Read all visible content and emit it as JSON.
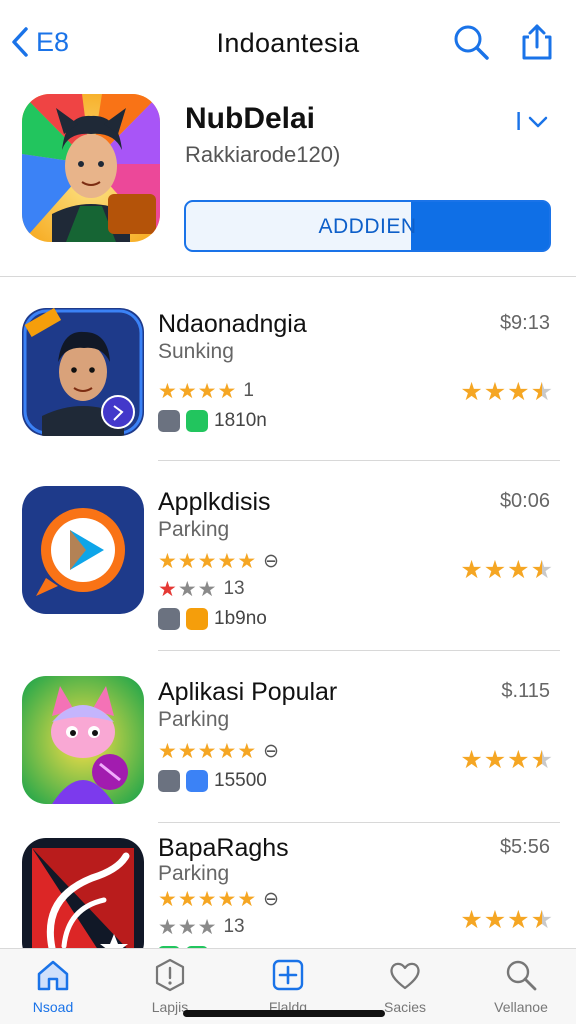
{
  "header": {
    "back_label": "E8",
    "title": "Indoantesia"
  },
  "featured": {
    "name": "NubDelai",
    "subtitle": "Rakkiarode120)",
    "more_label": "I",
    "button_label": "ADDDIEN"
  },
  "apps": [
    {
      "name": "Ndaonadngia",
      "category": "Sunking",
      "price": "$9:13",
      "stars_primary": {
        "value": "1"
      },
      "stars_secondary": null,
      "info_text": "1810n",
      "rating": 3.5
    },
    {
      "name": "Applkdisis",
      "category": "Parking",
      "price": "$0:06",
      "stars_primary": {
        "value": "⊖"
      },
      "stars_secondary": {
        "value": "13"
      },
      "info_text": "1b9no",
      "rating": 3.5
    },
    {
      "name": "Aplikasi Popular",
      "category": "Parking",
      "price": "$.115",
      "stars_primary": {
        "value": "⊖"
      },
      "stars_secondary": null,
      "info_text": "15500",
      "rating": 3.5
    },
    {
      "name": "BapaRaghs",
      "category": "Parking",
      "price": "$5:56",
      "stars_primary": {
        "value": "⊖"
      },
      "stars_secondary": {
        "value": "13"
      },
      "info_text": "",
      "rating": 3.5
    }
  ],
  "tabs": [
    {
      "label": "Nsoad",
      "icon": "home-icon",
      "active": true
    },
    {
      "label": "Lapjis",
      "icon": "hexagon-alert-icon",
      "active": false
    },
    {
      "label": "Flaldg",
      "icon": "plus-square-icon",
      "active": false
    },
    {
      "label": "Sacies",
      "icon": "heart-icon",
      "active": false
    },
    {
      "label": "Vellanoe",
      "icon": "search-icon",
      "active": false
    }
  ],
  "colors": {
    "accent": "#1a73e8",
    "star_gold": "#f5a623",
    "star_grey": "#8a8a8a",
    "star_red": "#e53935"
  }
}
